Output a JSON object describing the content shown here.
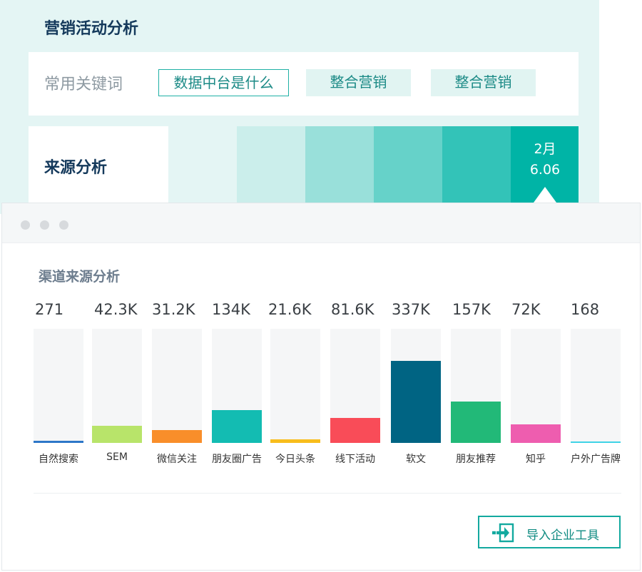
{
  "marketing": {
    "title": "营销活动分析",
    "keywords_label": "常用关键词",
    "keywords": [
      "数据中台是什么",
      "整合营销",
      "整合营销"
    ],
    "source_title": "来源分析",
    "heat_colors": [
      "#cbeeeb",
      "#99e0da",
      "#66d2c9",
      "#33c3b8",
      "#00b4a6"
    ],
    "highlight_month": "2月",
    "highlight_value": "6.06"
  },
  "window": {
    "dots": [
      "#d7dadd",
      "#d7dadd",
      "#d7dadd"
    ]
  },
  "chart": {
    "title": "渠道来源分析"
  },
  "chart_data": {
    "type": "bar",
    "title": "渠道来源分析",
    "categories": [
      "自然搜索",
      "SEM",
      "微信关注",
      "朋友圈广告",
      "今日头条",
      "线下活动",
      "软文",
      "朋友推荐",
      "知乎",
      "户外广告牌"
    ],
    "value_labels": [
      "271",
      "42.3K",
      "31.2K",
      "134K",
      "21.6K",
      "81.6K",
      "337K",
      "157K",
      "72K",
      "168"
    ],
    "values": [
      271,
      42300,
      31200,
      134000,
      21600,
      81600,
      337000,
      157000,
      72000,
      168
    ],
    "colors": [
      "#2d77c8",
      "#b8e46a",
      "#f98e2a",
      "#13bcb2",
      "#f8bd1c",
      "#f94c58",
      "#006483",
      "#22b978",
      "#ee5daf",
      "#40d3e6"
    ],
    "fill_fraction": [
      0.02,
      0.15,
      0.11,
      0.29,
      0.03,
      0.22,
      0.72,
      0.36,
      0.16,
      0.008
    ],
    "grid": false
  },
  "footer": {
    "import_label": "导入企业工具"
  }
}
